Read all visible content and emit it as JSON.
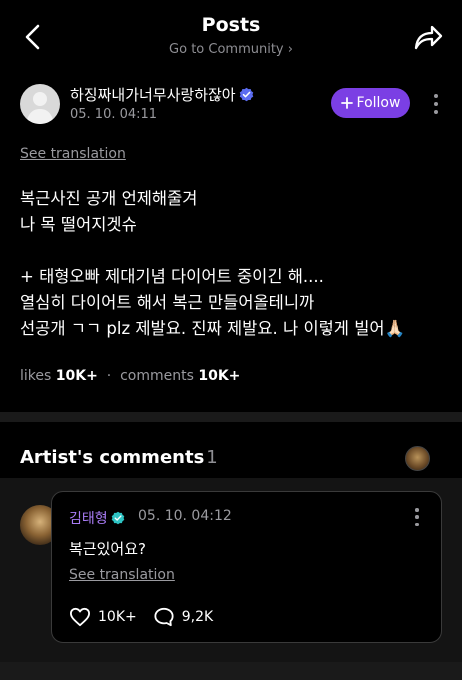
{
  "header": {
    "title": "Posts",
    "subtitle": "Go to Community ›"
  },
  "post": {
    "author_name": "하징짜내가너무사랑하잖아",
    "timestamp": "05. 10. 04:11",
    "follow_label": "Follow",
    "see_translation": "See translation",
    "body_lines": [
      "복근사진 공개 언제해줄겨",
      "나 목 떨어지겟슈",
      "",
      "+ 태형오빠 제대기념 다이어트 중이긴 해....",
      "열심히 다이어트 해서 복근 만들어올테니까",
      "선공개 ㄱㄱ plz 제발요. 진짜 제발요. 나 이렇게 빌어🙏🏻"
    ],
    "likes_label": "likes",
    "likes_value": "10K+",
    "stats_separator": "·",
    "comments_label": "comments",
    "comments_value": "10K+"
  },
  "artist_comments": {
    "title": "Artist's comments",
    "count": "1",
    "comment": {
      "author_name": "김태형",
      "timestamp": "05. 10. 04:12",
      "text": "복근있어요?",
      "see_translation": "See translation",
      "likes_value": "10K+",
      "replies_value": "9,2K"
    }
  },
  "colors": {
    "background": "#000000",
    "follow_button": "#7b3fe4",
    "artist_name": "#a97cf5",
    "verified_badge_author": "#5b6cf0",
    "verified_badge_artist": "#2ec4c4",
    "muted_text": "#9a9a9f"
  },
  "icons": {
    "back": "chevron-left-icon",
    "share": "share-arrow-icon",
    "follow": "plus-icon",
    "more": "vertical-dots-icon",
    "verified": "verified-badge-icon",
    "like": "heart-outline-icon",
    "reply": "speech-bubble-icon"
  }
}
